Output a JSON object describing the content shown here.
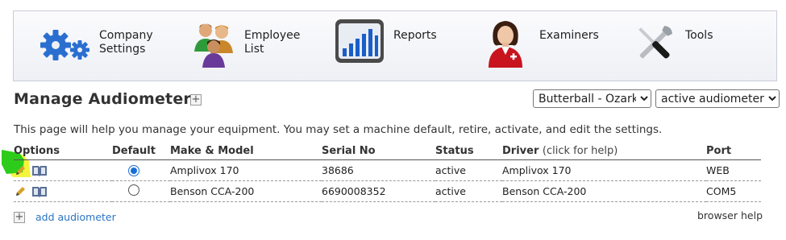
{
  "nav": {
    "items": [
      {
        "label": "Company\nSettings",
        "icon": "gears-icon"
      },
      {
        "label": "Employee\nList",
        "icon": "people-icon"
      },
      {
        "label": "Reports",
        "icon": "bar-chart-icon"
      },
      {
        "label": "Examiners",
        "icon": "examiner-icon"
      },
      {
        "label": "Tools",
        "icon": "tools-icon"
      }
    ]
  },
  "page": {
    "title": "Manage Audiometers",
    "description": "This page will help you manage your equipment. You may set a machine default, retire, activate, and edit the settings.",
    "location_select": "Butterball - Ozark",
    "filter_select": "active audiometers"
  },
  "table": {
    "headers": {
      "options": "Options",
      "default": "Default",
      "make_model": "Make & Model",
      "serial": "Serial No",
      "status": "Status",
      "driver": "Driver",
      "driver_help": "(click for help)",
      "port": "Port"
    },
    "rows": [
      {
        "default": true,
        "make_model": "Amplivox 170",
        "serial": "38686",
        "status": "active",
        "driver": "Amplivox 170",
        "port": "WEB"
      },
      {
        "default": false,
        "make_model": "Benson CCA-200",
        "serial": "6690008352",
        "status": "active",
        "driver": "Benson CCA-200",
        "port": "COM5"
      }
    ]
  },
  "footer": {
    "add_label": "add audiometer",
    "browser_help": "browser help"
  },
  "colors": {
    "accent_blue": "#1a6fd6",
    "link": "#2a74c4",
    "highlight_green": "#2ecc1a",
    "highlight_yellow": "#f2f21a"
  }
}
